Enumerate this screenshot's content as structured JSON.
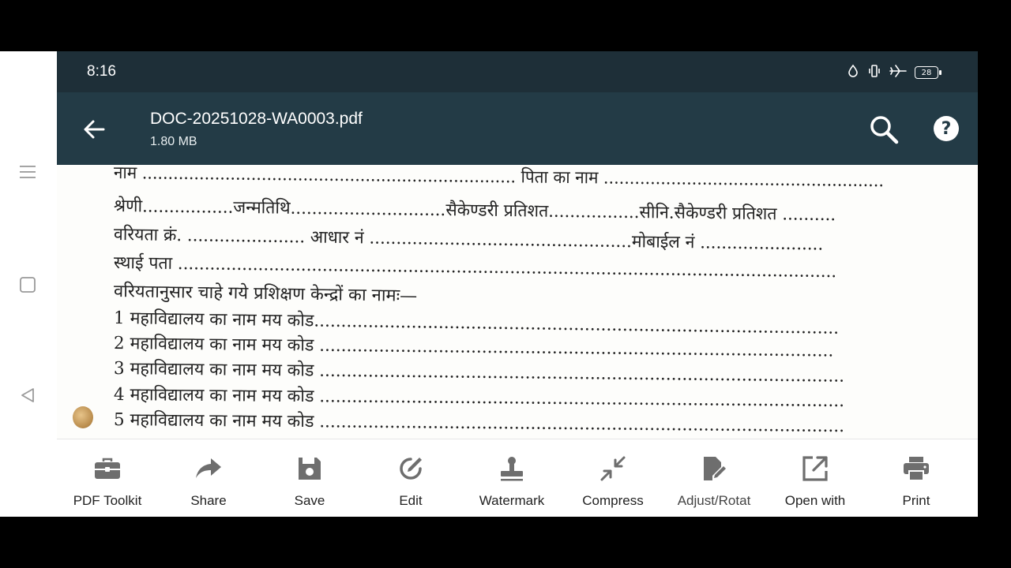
{
  "status_bar": {
    "time": "8:16",
    "battery_level": "28"
  },
  "header": {
    "file_name": "DOC-20251028-WA0003.pdf",
    "file_size": "1.80 MB"
  },
  "document": {
    "lines": [
      "नाम ........................................................................ पिता का नाम ......................................................",
      "श्रेणी.................जन्मतिथि.............................सैकेण्डरी प्रतिशत.................सीनि.सैकेण्डरी प्रतिशत ..........",
      "वरियता क्रं. ...................... आधार नं .................................................मोबाईल नं .......................",
      "स्थाई पता ...........................................................................................................................",
      "वरियतानुसार चाहे गये प्रशिक्षण केन्द्रों का नामः—",
      "1 महाविद्यालय का नाम मय कोड.................................................................................................",
      "2 महाविद्यालय का नाम मय कोड ...............................................................................................",
      "3 महाविद्यालय का नाम मय कोड .................................................................................................",
      "4 महाविद्यालय का नाम मय कोड .................................................................................................",
      "5 महाविद्यालय का नाम मय कोड ................................................................................................."
    ]
  },
  "toolbar": {
    "items": [
      {
        "label": "PDF Toolkit",
        "icon": "toolbox-icon"
      },
      {
        "label": "Share",
        "icon": "share-icon"
      },
      {
        "label": "Save",
        "icon": "save-icon"
      },
      {
        "label": "Edit",
        "icon": "edit-icon"
      },
      {
        "label": "Watermark",
        "icon": "watermark-icon"
      },
      {
        "label": "Compress",
        "icon": "compress-icon"
      },
      {
        "label": "Adjust/Rotat",
        "icon": "adjust-rotate-icon"
      },
      {
        "label": "Open with",
        "icon": "open-with-icon"
      },
      {
        "label": "Print",
        "icon": "print-icon"
      }
    ]
  },
  "colors": {
    "status_bar": "#1e2f38",
    "app_bar": "#233b46",
    "icon_gray": "#6e6e6e"
  }
}
